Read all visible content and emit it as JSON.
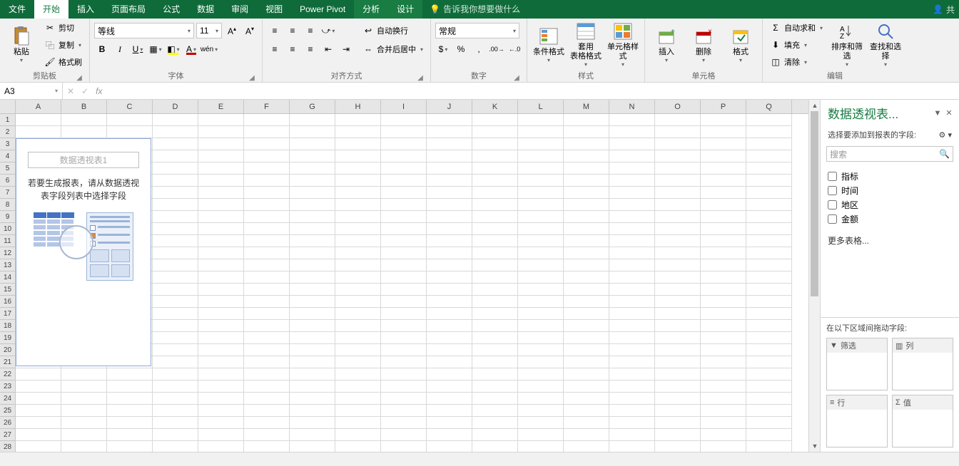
{
  "tabs": {
    "file": "文件",
    "home": "开始",
    "insert": "插入",
    "layout": "页面布局",
    "formulas": "公式",
    "data": "数据",
    "review": "审阅",
    "view": "视图",
    "powerpivot": "Power Pivot",
    "analyze": "分析",
    "design": "设计",
    "tellme": "告诉我你想要做什么",
    "share": "共"
  },
  "clipboard": {
    "paste": "粘贴",
    "cut": "剪切",
    "copy": "复制",
    "format_painter": "格式刷",
    "group": "剪贴板"
  },
  "font": {
    "name": "等线",
    "size": "11",
    "group": "字体"
  },
  "align": {
    "wrap": "自动换行",
    "merge": "合并后居中",
    "group": "对齐方式"
  },
  "number": {
    "format": "常规",
    "group": "数字"
  },
  "styles": {
    "cond": "条件格式",
    "table": "套用\n表格格式",
    "cell": "单元格样式",
    "group": "样式"
  },
  "cells": {
    "insert": "插入",
    "delete": "删除",
    "format": "格式",
    "group": "单元格"
  },
  "editing": {
    "autosum": "自动求和",
    "fill": "填充",
    "clear": "清除",
    "sort": "排序和筛选",
    "find": "查找和选择",
    "group": "编辑"
  },
  "namebox": "A3",
  "pivot_placeholder": {
    "title": "数据透视表1",
    "hint": "若要生成报表，请从数据透视表字段列表中选择字段"
  },
  "taskpane": {
    "title": "数据透视表...",
    "subtitle": "选择要添加到报表的字段:",
    "search_placeholder": "搜索",
    "fields": [
      "指标",
      "时间",
      "地区",
      "金额"
    ],
    "more": "更多表格...",
    "areas_label": "在以下区域间拖动字段:",
    "areas": {
      "filter": "筛选",
      "columns": "列",
      "rows": "行",
      "values": "值"
    }
  },
  "columns": [
    "A",
    "B",
    "C",
    "D",
    "E",
    "F",
    "G",
    "H",
    "I",
    "J",
    "K",
    "L",
    "M",
    "N",
    "O",
    "P",
    "Q"
  ],
  "row_count": 28
}
